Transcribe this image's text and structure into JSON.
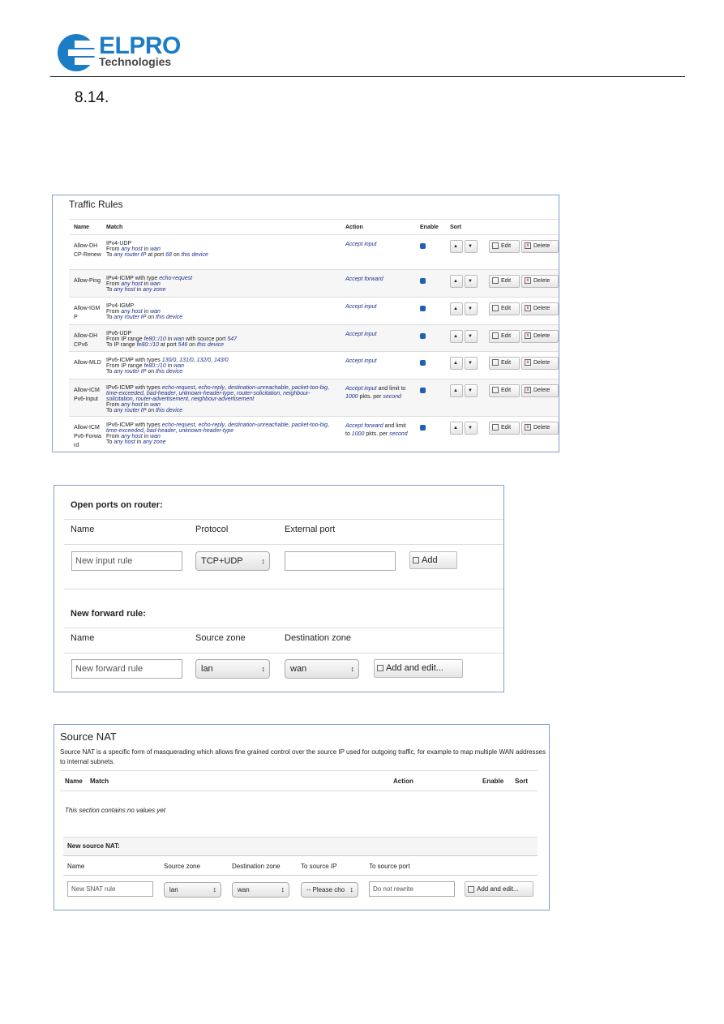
{
  "header": {
    "logo_main": "ELPRO",
    "logo_sub": "Technologies",
    "brand_color": "#1d7cc6",
    "section_number": "8.14."
  },
  "traffic_rules": {
    "title": "Traffic Rules",
    "columns": [
      "Name",
      "Match",
      "Action",
      "Enable",
      "Sort"
    ],
    "edit_label": "Edit",
    "delete_label": "Delete",
    "rows": [
      {
        "name": "Allow-DHCP-Renew",
        "match": [
          [
            [
              "IPv4-UDP",
              0
            ]
          ],
          [
            [
              "From ",
              0
            ],
            [
              "any host",
              1
            ],
            [
              " in ",
              0
            ],
            [
              "wan",
              1
            ]
          ],
          [
            [
              "To ",
              0
            ],
            [
              "any router IP",
              1
            ],
            [
              " at port ",
              0
            ],
            [
              "68",
              1
            ],
            [
              " on ",
              0
            ],
            [
              "this device",
              1
            ]
          ]
        ],
        "action": [
          [
            "Accept input",
            1
          ]
        ],
        "enabled": true
      },
      {
        "name": "Allow-Ping",
        "match": [
          [
            [
              "IPv4-ICMP with type ",
              0
            ],
            [
              "echo-request",
              1
            ]
          ],
          [
            [
              "From ",
              0
            ],
            [
              "any host",
              1
            ],
            [
              " in ",
              0
            ],
            [
              "wan",
              1
            ]
          ],
          [
            [
              "To ",
              0
            ],
            [
              "any host",
              1
            ],
            [
              " in ",
              0
            ],
            [
              "any zone",
              1
            ]
          ]
        ],
        "action": [
          [
            "Accept forward",
            1
          ]
        ],
        "enabled": true
      },
      {
        "name": "Allow-IGMP",
        "match": [
          [
            [
              "IPv4-IGMP",
              0
            ]
          ],
          [
            [
              "From ",
              0
            ],
            [
              "any host",
              1
            ],
            [
              " in ",
              0
            ],
            [
              "wan",
              1
            ]
          ],
          [
            [
              "To ",
              0
            ],
            [
              "any router IP",
              1
            ],
            [
              " on ",
              0
            ],
            [
              "this device",
              1
            ]
          ]
        ],
        "action": [
          [
            "Accept input",
            1
          ]
        ],
        "enabled": true
      },
      {
        "name": "Allow-DHCPv6",
        "match": [
          [
            [
              "IPv6-UDP",
              0
            ]
          ],
          [
            [
              "From IP range ",
              0
            ],
            [
              "fe80::/10",
              1
            ],
            [
              " in ",
              0
            ],
            [
              "wan",
              1
            ],
            [
              " with source port ",
              0
            ],
            [
              "547",
              1
            ]
          ],
          [
            [
              "To IP range ",
              0
            ],
            [
              "fe80::/10",
              1
            ],
            [
              " at port ",
              0
            ],
            [
              "546",
              1
            ],
            [
              " on ",
              0
            ],
            [
              "this device",
              1
            ]
          ]
        ],
        "action": [
          [
            "Accept input",
            1
          ]
        ],
        "enabled": true
      },
      {
        "name": "Allow-MLD",
        "match": [
          [
            [
              "IPv6-ICMP with types ",
              0
            ],
            [
              "130/0",
              1
            ],
            [
              ", ",
              0
            ],
            [
              "131/0",
              1
            ],
            [
              ", ",
              0
            ],
            [
              "132/0",
              1
            ],
            [
              ", ",
              0
            ],
            [
              "143/0",
              1
            ]
          ],
          [
            [
              "From IP range ",
              0
            ],
            [
              "fe80::/10",
              1
            ],
            [
              " in ",
              0
            ],
            [
              "wan",
              1
            ]
          ],
          [
            [
              "To ",
              0
            ],
            [
              "any router IP",
              1
            ],
            [
              " on ",
              0
            ],
            [
              "this device",
              1
            ]
          ]
        ],
        "action": [
          [
            "Accept input",
            1
          ]
        ],
        "enabled": true
      },
      {
        "name": "Allow-ICMPv6-Input",
        "match": [
          [
            [
              "IPv6-ICMP with types ",
              0
            ],
            [
              "echo-request",
              1
            ],
            [
              ", ",
              0
            ],
            [
              "echo-reply",
              1
            ],
            [
              ", ",
              0
            ],
            [
              "destination-unreachable",
              1
            ],
            [
              ", ",
              0
            ],
            [
              "packet-too-big",
              1
            ],
            [
              ",",
              0
            ]
          ],
          [
            [
              "time-exceeded",
              1
            ],
            [
              ", ",
              0
            ],
            [
              "bad-header",
              1
            ],
            [
              ", ",
              0
            ],
            [
              "unknown-header-type",
              1
            ],
            [
              ", ",
              0
            ],
            [
              "router-solicitation",
              1
            ],
            [
              ", ",
              0
            ],
            [
              "neighbour-",
              1
            ]
          ],
          [
            [
              "solicitation",
              1
            ],
            [
              ", ",
              0
            ],
            [
              "router-advertisement",
              1
            ],
            [
              ", ",
              0
            ],
            [
              "neighbour-advertisement",
              1
            ]
          ],
          [
            [
              "From ",
              0
            ],
            [
              "any host",
              1
            ],
            [
              " in ",
              0
            ],
            [
              "wan",
              1
            ]
          ],
          [
            [
              "To ",
              0
            ],
            [
              "any router IP",
              1
            ],
            [
              " on ",
              0
            ],
            [
              "this device",
              1
            ]
          ]
        ],
        "action": [
          [
            "Accept input",
            1
          ],
          [
            " and limit to ",
            0
          ],
          [
            "1000",
            1
          ],
          [
            " pkts. per ",
            0
          ],
          [
            "second",
            1
          ]
        ],
        "enabled": true
      },
      {
        "name": "Allow-ICMPv6-Forward",
        "match": [
          [
            [
              "IPv6-ICMP with types ",
              0
            ],
            [
              "echo-request",
              1
            ],
            [
              ", ",
              0
            ],
            [
              "echo-reply",
              1
            ],
            [
              ", ",
              0
            ],
            [
              "destination-unreachable",
              1
            ],
            [
              ", ",
              0
            ],
            [
              "packet-too-big",
              1
            ],
            [
              ",",
              0
            ]
          ],
          [
            [
              "time-exceeded",
              1
            ],
            [
              ", ",
              0
            ],
            [
              "bad-header",
              1
            ],
            [
              ", ",
              0
            ],
            [
              "unknown-header-type",
              1
            ]
          ],
          [
            [
              "From ",
              0
            ],
            [
              "any host",
              1
            ],
            [
              " in ",
              0
            ],
            [
              "wan",
              1
            ]
          ],
          [
            [
              "To ",
              0
            ],
            [
              "any host",
              1
            ],
            [
              " in ",
              0
            ],
            [
              "any zone",
              1
            ]
          ]
        ],
        "action": [
          [
            "Accept forward",
            1
          ],
          [
            " and limit to ",
            0
          ],
          [
            "1000",
            1
          ],
          [
            " pkts. per ",
            0
          ],
          [
            "second",
            1
          ]
        ],
        "enabled": true
      }
    ]
  },
  "open_ports": {
    "title": "Open ports on router:",
    "col_name": "Name",
    "col_protocol": "Protocol",
    "col_port": "External port",
    "name_placeholder": "New input rule",
    "protocol": "TCP+UDP",
    "port_value": "",
    "add_label": "Add",
    "fwd_title": "New forward rule:",
    "fwd_col_name": "Name",
    "fwd_col_src": "Source zone",
    "fwd_col_dst": "Destination zone",
    "fwd_name_placeholder": "New forward rule",
    "fwd_src": "lan",
    "fwd_dst": "wan",
    "fwd_add_label": "Add and edit..."
  },
  "source_nat": {
    "title": "Source NAT",
    "description": "Source NAT is a specific form of masquerading which allows fine grained control over the source IP used for outgoing traffic, for example to map multiple WAN addresses to internal subnets.",
    "columns": [
      "Name",
      "Match",
      "Action",
      "Enable",
      "Sort"
    ],
    "empty": "This section contains no values yet",
    "new_title": "New source NAT:",
    "form_cols": [
      "Name",
      "Source zone",
      "Destination zone",
      "To source IP",
      "To source port"
    ],
    "name_placeholder": "New SNAT rule",
    "src": "lan",
    "dst": "wan",
    "src_ip": "-- Please cho",
    "src_port": "Do not rewrite",
    "add_label": "Add and edit..."
  }
}
